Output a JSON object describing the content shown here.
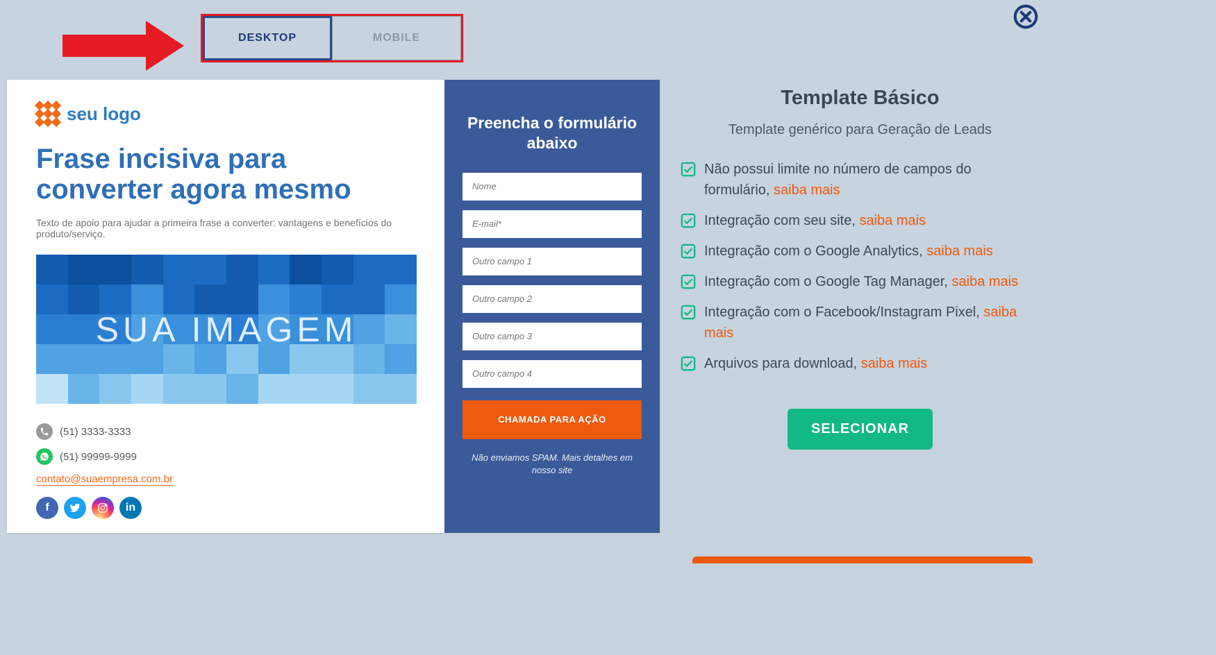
{
  "tabs": {
    "desktop": "DESKTOP",
    "mobile": "MOBILE"
  },
  "preview": {
    "logo_text": "seu logo",
    "headline": "Frase incisiva para converter agora mesmo",
    "subtext": "Texto de apoio para ajudar a primeira frase a converter: vantagens e benefícios do produto/serviço.",
    "image_overlay": "SUA IMAGEM",
    "phone": "(51) 3333-3333",
    "whatsapp": "(51) 99999-9999",
    "email": "contato@suaempresa.com.br",
    "form": {
      "title": "Preencha o formulário abaixo",
      "fields": {
        "name": "Nome",
        "email": "E-mail*",
        "f1": "Outro campo 1",
        "f2": "Outro campo 2",
        "f3": "Outro campo 3",
        "f4": "Outro campo 4"
      },
      "cta": "CHAMADA PARA AÇÃO",
      "spam": "Não enviamos SPAM. Mais detalhes em nosso site"
    }
  },
  "details": {
    "title": "Template Básico",
    "description": "Template genérico para Geração de Leads",
    "features": {
      "f0_text": "Não possui limite no número de campos do formulário, ",
      "f1_text": "Integração com seu site, ",
      "f2_text": "Integração com o Google Analytics, ",
      "f3_text": "Integração com o Google Tag Manager, ",
      "f4_text": "Integração com o Facebook/Instagram Pixel, ",
      "f5_text": "Arquivos para download, ",
      "learn_more": "saiba mais"
    },
    "select_button": "SELECIONAR"
  }
}
